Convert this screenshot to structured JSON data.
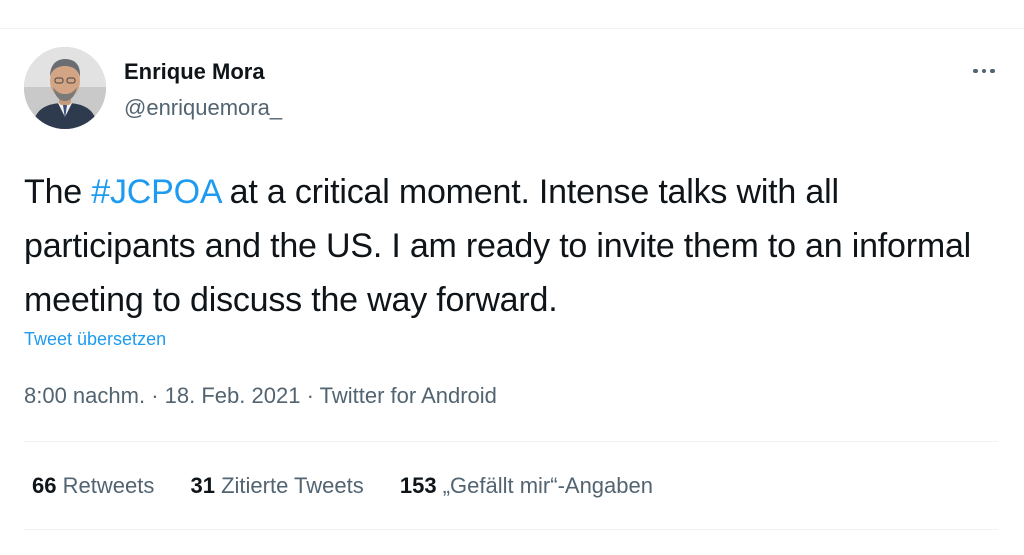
{
  "tweet": {
    "author_name": "Enrique Mora",
    "author_handle": "@enriquemora_",
    "text_before": "The ",
    "hashtag": "#JCPOA",
    "text_after": " at a critical moment. Intense talks with all participants and the US. I am ready to invite them to an informal meeting to discuss the way forward.",
    "translate_label": "Tweet übersetzen",
    "time": "8:00 nachm.",
    "separator": "·",
    "date": "18. Feb. 2021",
    "source": "Twitter for Android"
  },
  "stats": {
    "retweets_count": "66",
    "retweets_label": "Retweets",
    "quotes_count": "31",
    "quotes_label": "Zitierte Tweets",
    "likes_count": "153",
    "likes_label": "„Gefällt mir“-Angaben"
  },
  "icons": {
    "more": "more-horizontal-icon",
    "avatar": "profile-photo"
  },
  "colors": {
    "accent": "#1d9bf0",
    "secondary_text": "#536471",
    "primary_text": "#0f1419",
    "divider": "#eff3f4"
  }
}
